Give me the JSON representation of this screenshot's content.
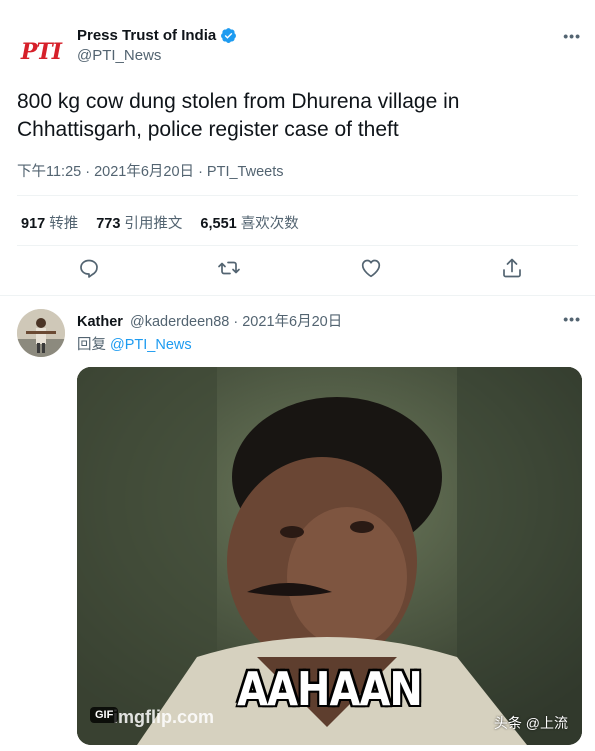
{
  "main_tweet": {
    "author": {
      "name": "Press Trust of India",
      "handle": "@PTI_News",
      "avatar_text": "PTI",
      "verified_color": "#1d9bf0"
    },
    "more_label": "•••",
    "text_line1": "800 kg cow dung stolen from Dhurena village in",
    "text_line2": "Chhattisgarh, police register case of theft",
    "meta": "下午11:25 · 2021年6月20日 · PTI_Tweets",
    "stats": [
      {
        "value": "917",
        "label": "转推"
      },
      {
        "value": "773",
        "label": "引用推文"
      },
      {
        "value": "6,551",
        "label": "喜欢次数"
      }
    ],
    "actions": [
      "reply-icon",
      "retweet-icon",
      "like-icon",
      "share-icon"
    ]
  },
  "reply_tweet": {
    "author": {
      "name": "Kather",
      "handle": "@kaderdeen88",
      "date": "· 2021年6月20日"
    },
    "more_label": "•••",
    "reply_prefix": "回复",
    "reply_to": "@PTI_News",
    "media": {
      "caption": "AAHAAN",
      "badge": "GIF",
      "source_mark": "imgflip.com"
    }
  },
  "watermark": "头条 @上流",
  "colors": {
    "text": "#0f1419",
    "secondary": "#536471",
    "link": "#1d9bf0",
    "divider": "#eff3f4",
    "brand_red": "#d6202a"
  }
}
